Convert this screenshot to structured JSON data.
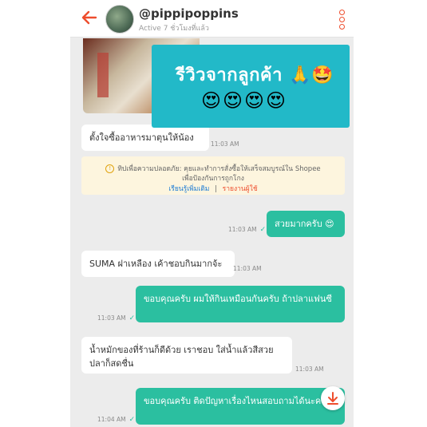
{
  "header": {
    "username": "@pippipoppins",
    "status": "Active 7 ชั่วโมงที่แล้ว"
  },
  "banner": {
    "line1": "รีวิวจากลูกค้า 🙏🤩",
    "line2": "😍😍😍😍"
  },
  "messages": [
    {
      "text": "ตั้งใจซื้ออาหารมาตุนให้น้อง",
      "time": "11:03 AM"
    },
    {
      "text": "สวยมากครับ 😍",
      "time": "11:03 AM"
    },
    {
      "text": "SUMA ฝาเหลือง เค้าชอบกินมากจ้ะ",
      "time": "11:03 AM"
    },
    {
      "text": "ขอบคุณครับ ผมให้กินเหมือนกันครับ ถ้าปลาแฟนซี",
      "time": "11:03 AM"
    },
    {
      "text": "น้ำหมักของที่ร้านก็ดีด้วย เราชอบ ใส่น้ำแล้วสีสวย ปลาก็สดชื่น",
      "time": "11:03 AM"
    },
    {
      "text": "ขอบคุณครับ ติดปัญหาเรื่องไหนสอบถามได้นะครับ",
      "time": "11:04 AM"
    }
  ],
  "notice": {
    "row1": "ทิปเพื่อความปลอดภัย: คุยและทำการสั่งซื้อให้เสร็จสมบูรณ์ใน Shopee",
    "row2": "เพื่อป้องกันการถูกโกง",
    "learn_more": "เรียนรู้เพิ่มเติม",
    "separator": "|",
    "report": "รายงานผู้ใช้"
  },
  "colors": {
    "accent": "#ee4d2d",
    "outgoing_bubble": "#2bbfa0",
    "banner": "#22b9c8"
  }
}
